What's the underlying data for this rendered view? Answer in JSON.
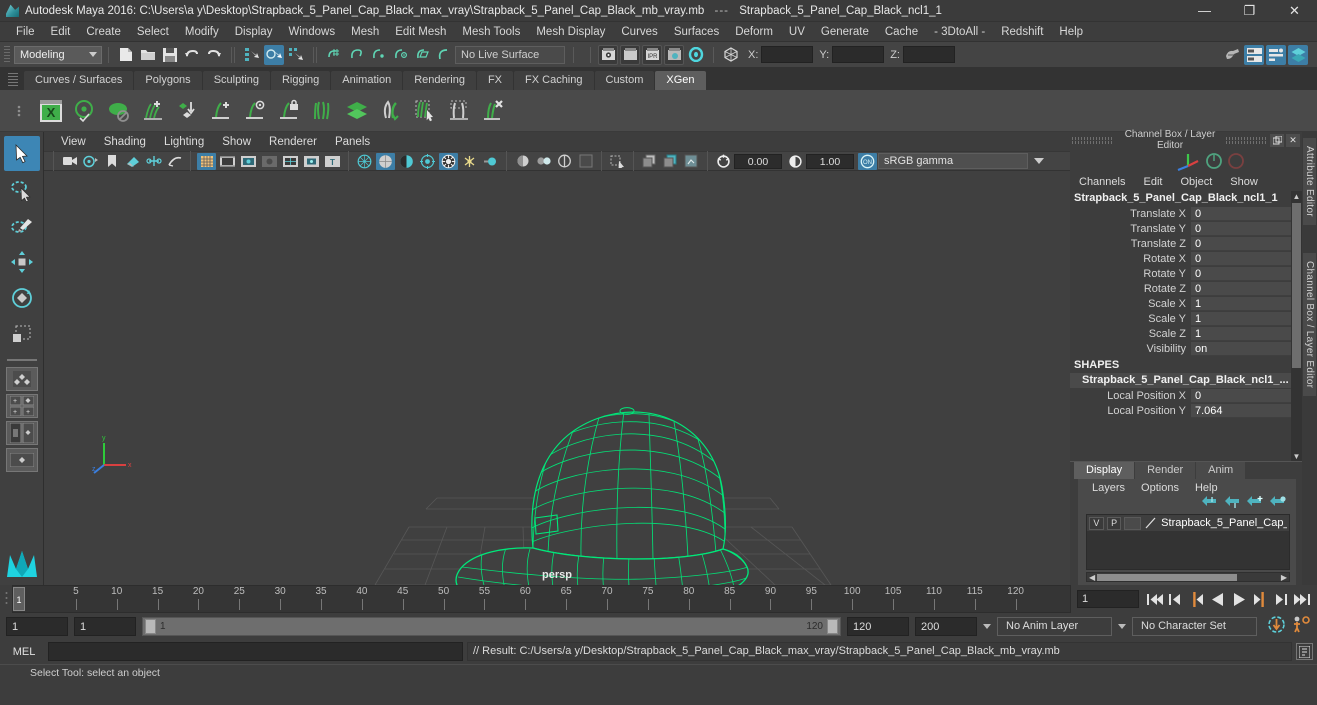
{
  "window": {
    "app_title": "Autodesk Maya 2016:",
    "file_path": "C:\\Users\\a y\\Desktop\\Strapback_5_Panel_Cap_Black_max_vray\\Strapback_5_Panel_Cap_Black_mb_vray.mb",
    "separator": "---",
    "node_name": "Strapback_5_Panel_Cap_Black_ncl1_1",
    "minimize": "—",
    "maximize": "❐",
    "close": "✕",
    "logo_icon": "maya-logo-icon"
  },
  "menubar": {
    "items": [
      "File",
      "Edit",
      "Create",
      "Select",
      "Modify",
      "Display",
      "Windows",
      "Mesh",
      "Edit Mesh",
      "Mesh Tools",
      "Mesh Display",
      "Curves",
      "Surfaces",
      "Deform",
      "UV",
      "Generate",
      "Cache",
      "- 3DtoAll -",
      "Redshift",
      "Help"
    ]
  },
  "statusline": {
    "mode": "Modeling",
    "live_surface": "No Live Surface",
    "coord_x_label": "X:",
    "coord_y_label": "Y:",
    "coord_z_label": "Z:",
    "coord_x_value": "",
    "coord_y_value": "",
    "coord_z_value": "",
    "icons": [
      "new-scene-icon",
      "open-scene-icon",
      "save-scene-icon",
      "undo-icon",
      "redo-icon",
      "select-by-hierarchy-icon",
      "select-by-object-type-icon",
      "select-by-component-type-icon",
      "snap-to-grids-icon",
      "snap-to-curves-icon",
      "snap-to-points-icon",
      "snap-to-projected-center-icon",
      "snap-to-view-planes-icon",
      "make-live-icon",
      "render-current-frame-icon",
      "ipr-render-icon",
      "render-settings-icon",
      "hypershade-icon",
      "render-view-icon",
      "construction-history-icon"
    ],
    "right_icons": [
      "modeling-toolkit-icon",
      "attribute-editor-icon",
      "tool-settings-icon",
      "channel-box-icon"
    ]
  },
  "shelf": {
    "tabs": [
      "Curves / Surfaces",
      "Polygons",
      "Sculpting",
      "Rigging",
      "Animation",
      "Rendering",
      "FX",
      "FX Caching",
      "Custom",
      "XGen"
    ],
    "active_tab": "XGen",
    "icons": [
      "xgen-editor-icon",
      "xgen-preview-icon",
      "xgen-guide-icon",
      "xgen-add-guides-icon",
      "xgen-place-icon",
      "xgen-add-density-icon",
      "xgen-visible-icon",
      "xgen-lock-icon",
      "xgen-part-icon",
      "xgen-layers-icon",
      "xgen-clump-icon",
      "xgen-select-guides-icon",
      "xgen-region-icon",
      "xgen-delete-icon"
    ]
  },
  "toolbox": {
    "items": [
      "select-tool",
      "lasso-select-tool",
      "paint-select-tool",
      "move-tool",
      "rotate-tool",
      "scale-tool"
    ],
    "selected": "select-tool",
    "layouts": [
      "single-perspective-layout",
      "four-view-layout",
      "persp-outliner-layout",
      "hypergraph-layout"
    ]
  },
  "viewport": {
    "menus": [
      "View",
      "Shading",
      "Lighting",
      "Show",
      "Renderer",
      "Panels"
    ],
    "camera_label": "persp",
    "exposure_value": "0.00",
    "gamma_value": "1.00",
    "color_space": "sRGB gamma",
    "toolbar_icons": [
      "camera-select-icon",
      "camera-attributes-icon",
      "bookmark-icon",
      "image-plane-icon",
      "two-sided-lighting-icon",
      "shadows-icon",
      "grid-icon",
      "film-gate-icon",
      "resolution-gate-icon",
      "gate-mask-icon",
      "film-origin-icon",
      "safe-action-icon",
      "title-safe-icon",
      "wireframe-icon",
      "smooth-shade-all-icon",
      "shaded-textured-icon",
      "use-all-lights-icon",
      "shadows-toggle-icon",
      "screen-space-ao-icon",
      "motion-blur-icon",
      "multisample-icon",
      "depth-of-field-icon",
      "isolate-select-icon",
      "xray-icon",
      "xray-joints-icon",
      "xray-active-components-icon",
      "exposure-icon",
      "gamma-icon",
      "view-transform-icon"
    ],
    "model_name": "5-panel-cap-wireframe",
    "wireframe_color": "#00e87a"
  },
  "channel_box": {
    "panel_title": "Channel Box / Layer Editor",
    "menus": [
      "Channels",
      "Edit",
      "Object",
      "Show"
    ],
    "node_name": "Strapback_5_Panel_Cap_Black_ncl1_1",
    "transform_attrs": [
      {
        "label": "Translate X",
        "value": "0"
      },
      {
        "label": "Translate Y",
        "value": "0"
      },
      {
        "label": "Translate Z",
        "value": "0"
      },
      {
        "label": "Rotate X",
        "value": "0"
      },
      {
        "label": "Rotate Y",
        "value": "0"
      },
      {
        "label": "Rotate Z",
        "value": "0"
      },
      {
        "label": "Scale X",
        "value": "1"
      },
      {
        "label": "Scale Y",
        "value": "1"
      },
      {
        "label": "Scale Z",
        "value": "1"
      },
      {
        "label": "Visibility",
        "value": "on"
      }
    ],
    "shapes_header": "SHAPES",
    "shape_name": "Strapback_5_Panel_Cap_Black_ncl1_...",
    "shape_attrs": [
      {
        "label": "Local Position X",
        "value": "0"
      },
      {
        "label": "Local Position Y",
        "value": "7.064"
      }
    ]
  },
  "layer_editor": {
    "tabs": [
      "Display",
      "Render",
      "Anim"
    ],
    "active_tab": "Display",
    "menus": [
      "Layers",
      "Options",
      "Help"
    ],
    "buttons": [
      "move-layer-up-icon",
      "move-layer-down-icon",
      "create-new-layer-icon",
      "create-layer-from-selected-icon"
    ],
    "layers": [
      {
        "visibility": "V",
        "playback": "P",
        "name": "Strapback_5_Panel_Cap_"
      }
    ]
  },
  "vertical_tabs": [
    "Attribute Editor",
    "Channel Box / Layer Editor"
  ],
  "timeline": {
    "ticks": [
      5,
      10,
      15,
      20,
      25,
      30,
      35,
      40,
      45,
      50,
      55,
      60,
      65,
      70,
      75,
      80,
      85,
      90,
      95,
      100,
      105,
      110,
      115,
      120
    ],
    "current_frame": "1",
    "current_frame_field": "1",
    "playback_buttons": [
      "go-to-start-icon",
      "step-back-keyframe-icon",
      "step-back-frame-icon",
      "play-backwards-icon",
      "play-forwards-icon",
      "step-forward-frame-icon",
      "step-forward-keyframe-icon",
      "go-to-end-icon"
    ]
  },
  "range": {
    "start_field": "1",
    "anim_start_field": "1",
    "slider_start": "1",
    "slider_end": "120",
    "anim_end_field": "120",
    "end_field": "200",
    "anim_layer": "No Anim Layer",
    "character_set": "No Character Set",
    "auto_keyframe_icon": "auto-keyframe-icon",
    "animation_prefs_icon": "animation-preferences-icon"
  },
  "command_line": {
    "language": "MEL",
    "input_value": "",
    "result": "// Result: C:/Users/a y/Desktop/Strapback_5_Panel_Cap_Black_max_vray/Strapback_5_Panel_Cap_Black_mb_vray.mb",
    "script_editor_icon": "script-editor-icon"
  },
  "help_line": {
    "text": "Select Tool: select an object"
  },
  "colors": {
    "accent_blue": "#3d7ea6",
    "teal": "#4fb3bf",
    "green": "#5fa05f",
    "wireframe_green": "#00e87a",
    "panel_bg": "#3d3d3d",
    "viewport_bg": "#404040"
  }
}
